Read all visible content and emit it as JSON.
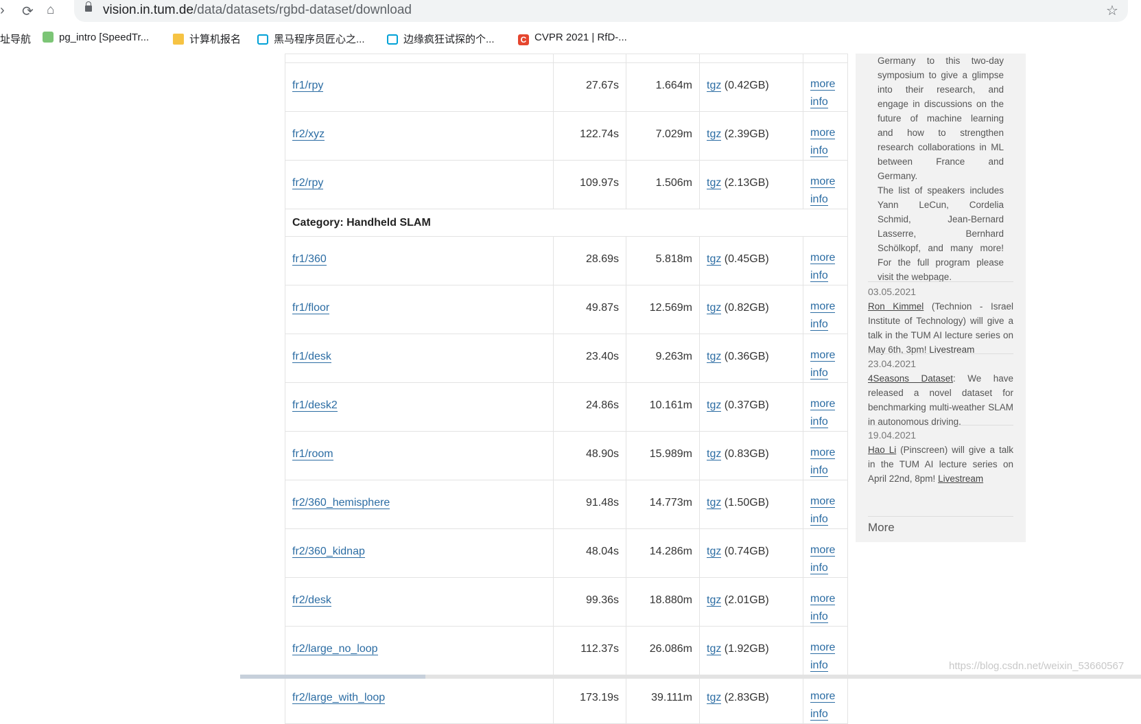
{
  "browser": {
    "url_host": "vision.in.tum.de",
    "url_path": "/data/datasets/rgbd-dataset/download"
  },
  "bookmarks": [
    {
      "label": "址导航"
    },
    {
      "label": "pg_intro [SpeedTr..."
    },
    {
      "label": "计算机报名"
    },
    {
      "label": "黑马程序员匠心之..."
    },
    {
      "label": "边缘疯狂试探的个..."
    },
    {
      "label": "CVPR 2021 | RfD-..."
    }
  ],
  "table": {
    "rows_before": [
      {
        "name": "fr1/rpy",
        "duration": "27.67s",
        "length": "1.664m",
        "tgz": "tgz",
        "size": "(0.42GB)",
        "more": "more",
        "info": "info"
      },
      {
        "name": "fr2/xyz",
        "duration": "122.74s",
        "length": "7.029m",
        "tgz": "tgz",
        "size": "(2.39GB)",
        "more": "more",
        "info": "info"
      },
      {
        "name": "fr2/rpy",
        "duration": "109.97s",
        "length": "1.506m",
        "tgz": "tgz",
        "size": "(2.13GB)",
        "more": "more",
        "info": "info"
      }
    ],
    "category": "Category: Handheld SLAM",
    "rows_after": [
      {
        "name": "fr1/360",
        "duration": "28.69s",
        "length": "5.818m",
        "tgz": "tgz",
        "size": "(0.45GB)",
        "more": "more",
        "info": "info"
      },
      {
        "name": "fr1/floor",
        "duration": "49.87s",
        "length": "12.569m",
        "tgz": "tgz",
        "size": "(0.82GB)",
        "more": "more",
        "info": "info"
      },
      {
        "name": "fr1/desk",
        "duration": "23.40s",
        "length": "9.263m",
        "tgz": "tgz",
        "size": "(0.36GB)",
        "more": "more",
        "info": "info"
      },
      {
        "name": "fr1/desk2",
        "duration": "24.86s",
        "length": "10.161m",
        "tgz": "tgz",
        "size": "(0.37GB)",
        "more": "more",
        "info": "info"
      },
      {
        "name": "fr1/room",
        "duration": "48.90s",
        "length": "15.989m",
        "tgz": "tgz",
        "size": "(0.83GB)",
        "more": "more",
        "info": "info"
      },
      {
        "name": "fr2/360_hemisphere",
        "duration": "91.48s",
        "length": "14.773m",
        "tgz": "tgz",
        "size": "(1.50GB)",
        "more": "more",
        "info": "info"
      },
      {
        "name": "fr2/360_kidnap",
        "duration": "48.04s",
        "length": "14.286m",
        "tgz": "tgz",
        "size": "(0.74GB)",
        "more": "more",
        "info": "info"
      },
      {
        "name": "fr2/desk",
        "duration": "99.36s",
        "length": "18.880m",
        "tgz": "tgz",
        "size": "(2.01GB)",
        "more": "more",
        "info": "info"
      },
      {
        "name": "fr2/large_no_loop",
        "duration": "112.37s",
        "length": "26.086m",
        "tgz": "tgz",
        "size": "(1.92GB)",
        "more": "more",
        "info": "info"
      },
      {
        "name": "fr2/large_with_loop",
        "duration": "173.19s",
        "length": "39.111m",
        "tgz": "tgz",
        "size": "(2.83GB)",
        "more": "more",
        "info": "info"
      }
    ]
  },
  "sidebar": {
    "intro_lines": [
      "Germany to this two-day",
      "symposium to give a glimpse",
      "into their research, and",
      "engage in discussions on the",
      "future of machine learning",
      "and how to strengthen",
      "research collaborations in ML",
      "between France and",
      "Germany.",
      "The list of speakers includes",
      "Yann LeCun, Cordelia",
      "Schmid, Jean-Bernard",
      "Lasserre, Bernhard",
      "Schölkopf, and many more!",
      "For the full program please",
      "visit the webpage."
    ],
    "news": [
      {
        "date": "03.05.2021",
        "link": "Ron Kimmel",
        "text": " (Technion - Israel Institute of Technology) will give a talk in the TUM AI lecture series on May 6th, 3pm! ",
        "link2": "Livestream"
      },
      {
        "date": "23.04.2021",
        "link": "4Seasons Dataset",
        "text": ": We have released a novel dataset for benchmarking multi-weather SLAM in autonomous driving.",
        "link2": ""
      },
      {
        "date": "19.04.2021",
        "link": "Hao Li",
        "text": " (Pinscreen) will give a talk in the TUM AI lecture series on April 22nd, 8pm! ",
        "link2": "Livestream"
      }
    ],
    "more_label": "More"
  },
  "watermark": "https://blog.csdn.net/weixin_53660567"
}
